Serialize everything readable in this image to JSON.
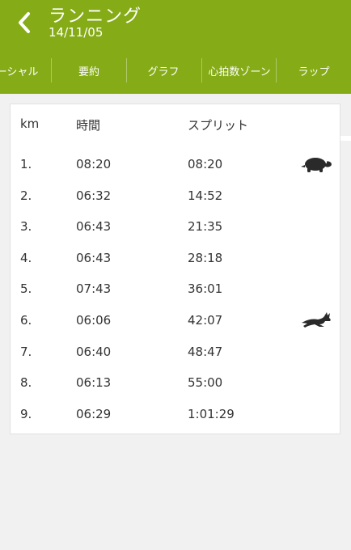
{
  "header": {
    "title": "ランニング",
    "date": "14/11/05",
    "back_icon": "chevron-left-icon"
  },
  "tabs": [
    {
      "label": "ーシャル",
      "selected": false
    },
    {
      "label": "要約",
      "selected": false
    },
    {
      "label": "グラフ",
      "selected": false
    },
    {
      "label": "心拍数ゾーン",
      "selected": false
    },
    {
      "label": "ラップ",
      "selected": true
    }
  ],
  "colors": {
    "accent": "#85ab17",
    "background": "#f1f1f1",
    "card": "#ffffff",
    "text": "#333333",
    "icon": "#2a2a2a"
  },
  "laps": {
    "columns": {
      "km": "km",
      "time": "時間",
      "split": "スプリット"
    },
    "rows": [
      {
        "km": "1.",
        "time": "08:20",
        "split": "08:20",
        "icon": "turtle-icon"
      },
      {
        "km": "2.",
        "time": "06:32",
        "split": "14:52",
        "icon": ""
      },
      {
        "km": "3.",
        "time": "06:43",
        "split": "21:35",
        "icon": ""
      },
      {
        "km": "4.",
        "time": "06:43",
        "split": "28:18",
        "icon": ""
      },
      {
        "km": "5.",
        "time": "07:43",
        "split": "36:01",
        "icon": ""
      },
      {
        "km": "6.",
        "time": "06:06",
        "split": "42:07",
        "icon": "rabbit-icon"
      },
      {
        "km": "7.",
        "time": "06:40",
        "split": "48:47",
        "icon": ""
      },
      {
        "km": "8.",
        "time": "06:13",
        "split": "55:00",
        "icon": ""
      },
      {
        "km": "9.",
        "time": "06:29",
        "split": "1:01:29",
        "icon": ""
      }
    ]
  }
}
